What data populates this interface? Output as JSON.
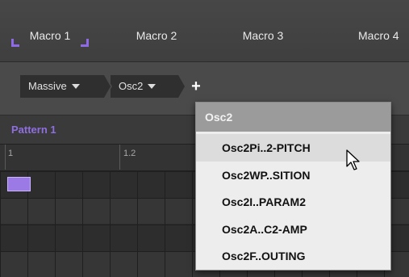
{
  "macros": [
    {
      "label": "Macro 1",
      "selected": true
    },
    {
      "label": "Macro 2",
      "selected": false
    },
    {
      "label": "Macro 3",
      "selected": false
    },
    {
      "label": "Macro 4",
      "selected": false
    }
  ],
  "chain": {
    "crumbs": [
      "Massive",
      "Osc2"
    ],
    "add_label": "+"
  },
  "pattern": {
    "title": "Pattern 1",
    "ticks": [
      "1",
      "1.2"
    ]
  },
  "menu": {
    "header": "Osc2",
    "items": [
      "Osc2Pi..2-PITCH",
      "Osc2WP..SITION",
      "Osc2I..PARAM2",
      "Osc2A..C2-AMP",
      "Osc2F..OUTING"
    ],
    "hovered_index": 0
  },
  "colors": {
    "accent": "#8e6ae6",
    "menu_bg": "#ededed",
    "menu_header_bg": "#9b9b9b"
  },
  "icons": {
    "cursor": "arrow-pointer-icon",
    "dropdown": "caret-down-icon"
  }
}
